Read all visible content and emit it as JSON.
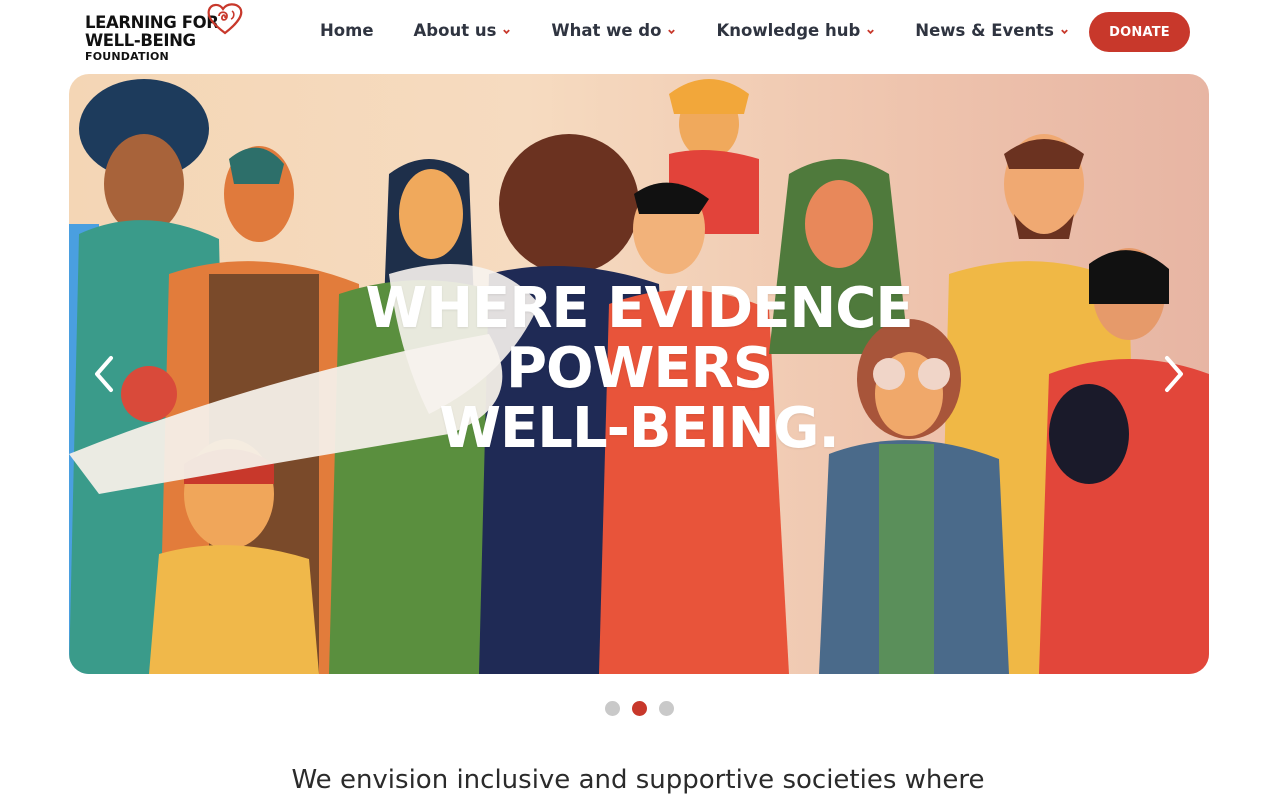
{
  "logo": {
    "line1": "LEARNING FOR",
    "line2": "WELL-BEING",
    "line3": "FOUNDATION",
    "icon": "heart-icon",
    "heart_color": "#c8382b"
  },
  "nav": {
    "items": [
      {
        "label": "Home",
        "has_dropdown": false
      },
      {
        "label": "About us",
        "has_dropdown": true
      },
      {
        "label": "What we do",
        "has_dropdown": true
      },
      {
        "label": "Knowledge hub",
        "has_dropdown": true
      },
      {
        "label": "News & Events",
        "has_dropdown": true
      }
    ],
    "dropdown_icon": "chevron-down-icon",
    "accent": "#c8382b"
  },
  "donate": {
    "label": "DONATE",
    "color": "#c8382b"
  },
  "hero": {
    "title_line1": "WHERE EVIDENCE",
    "title_line2": "POWERS",
    "title_line3": "WELL-BEING.",
    "prev_icon": "chevron-left-icon",
    "next_icon": "chevron-right-icon"
  },
  "carousel": {
    "slide_count": 3,
    "active_slide": 2
  },
  "mission": {
    "text": "We envision inclusive and supportive societies where"
  }
}
